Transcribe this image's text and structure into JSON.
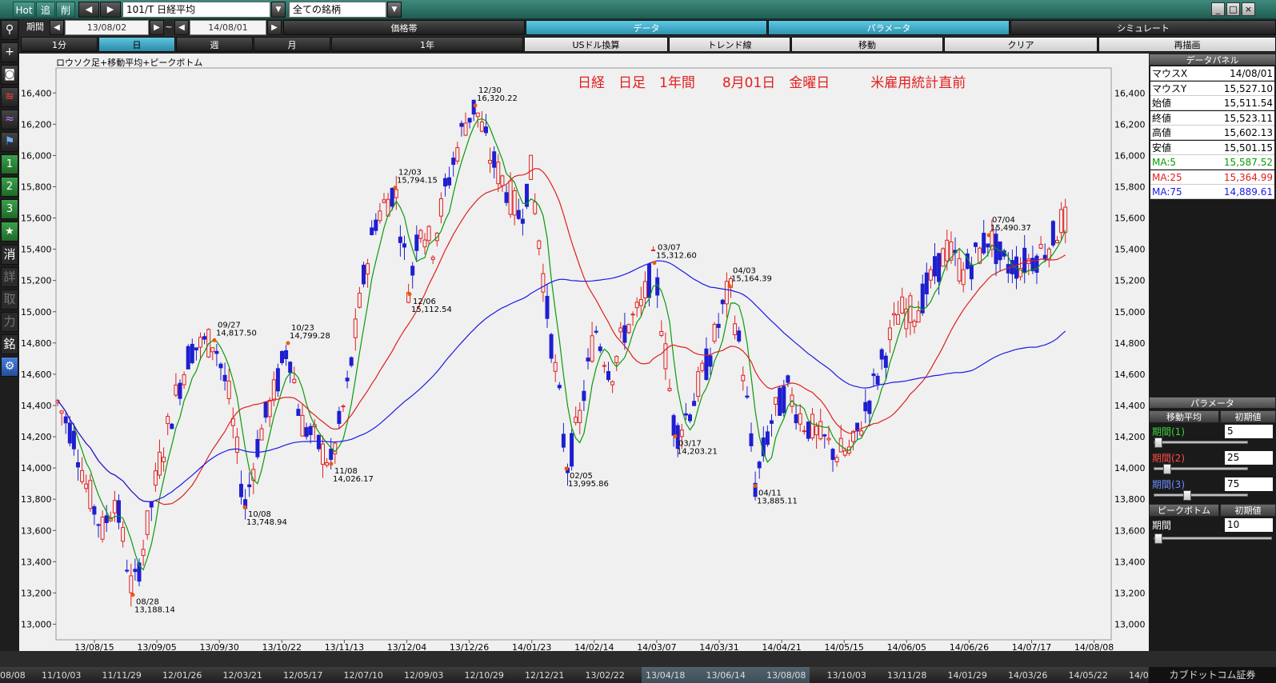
{
  "titlebar": {
    "tabs": [
      "Hot",
      "追",
      "削"
    ],
    "symbol": "101/T 日経平均",
    "universe": "全ての銘柄",
    "win_buttons": [
      "_",
      "□",
      "×"
    ]
  },
  "period_row": {
    "label": "期間",
    "from": "13/08/02",
    "sep": "~",
    "to": "14/08/01",
    "tabs": [
      "価格帯",
      "データ",
      "パラメータ",
      "シミュレート"
    ]
  },
  "range_row": {
    "tabs": [
      "1分",
      "日",
      "週",
      "月",
      "1年",
      "USドル換算",
      "トレンド線",
      "移動",
      "クリア",
      "再描画"
    ]
  },
  "tools": [
    "⚲",
    "+",
    "◙",
    "≋",
    "≈",
    "⚑",
    "1",
    "2",
    "3",
    "★",
    "消",
    "詳",
    "取",
    "力",
    "銘",
    "⚙"
  ],
  "chart": {
    "subtitle": "ロウソク足+移動平均+ピークボトム",
    "title": "日経　日足　1年間　　8月01日　金曜日　　　米雇用統計直前",
    "y_ticks": [
      "16,400",
      "16,200",
      "16,000",
      "15,800",
      "15,600",
      "15,400",
      "15,200",
      "15,000",
      "14,800",
      "14,600",
      "14,400",
      "14,200",
      "14,000",
      "13,800",
      "13,600",
      "13,400",
      "13,200",
      "13,000"
    ],
    "x_ticks": [
      "13/08/15",
      "13/09/05",
      "13/09/30",
      "13/10/22",
      "13/11/13",
      "13/12/04",
      "13/12/26",
      "14/01/23",
      "14/02/14",
      "14/03/07",
      "14/03/31",
      "14/04/21",
      "14/05/15",
      "14/06/05",
      "14/06/26",
      "14/07/17",
      "14/08/08"
    ],
    "colors": {
      "up": "#e02020",
      "down": "#1f1fd0",
      "ma5": "#0a9a0a",
      "ma25": "#e02020",
      "ma75": "#1a1ae6",
      "peak": "#f05a00"
    }
  },
  "chart_data": {
    "type": "candlestick",
    "ylim": [
      12900,
      16560
    ],
    "series": [
      {
        "name": "MA:5",
        "color": "#0a9a0a"
      },
      {
        "name": "MA:25",
        "color": "#e02020"
      },
      {
        "name": "MA:75",
        "color": "#1a1ae6"
      }
    ],
    "annotations": [
      {
        "date": "08/28",
        "value": "13,188.14"
      },
      {
        "date": "09/27",
        "value": "14,817.50"
      },
      {
        "date": "10/08",
        "value": "13,748.94"
      },
      {
        "date": "10/23",
        "value": "14,799.28"
      },
      {
        "date": "11/08",
        "value": "14,026.17"
      },
      {
        "date": "12/03",
        "value": "15,794.15"
      },
      {
        "date": "12/06",
        "value": "15,112.54"
      },
      {
        "date": "12/30",
        "value": "16,320.22"
      },
      {
        "date": "02/05",
        "value": "13,995.86"
      },
      {
        "date": "03/07",
        "value": "15,312.60"
      },
      {
        "date": "03/17",
        "value": "14,203.21"
      },
      {
        "date": "04/03",
        "value": "15,164.39"
      },
      {
        "date": "04/11",
        "value": "13,885.11"
      },
      {
        "date": "07/04",
        "value": "15,490.37"
      }
    ]
  },
  "data_panel": {
    "title": "データパネル",
    "rows": [
      {
        "k": "マウスX",
        "v": "14/08/01"
      },
      {
        "k": "マウスY",
        "v": "15,527.10"
      },
      {
        "k": "始値",
        "v": "15,511.54"
      },
      {
        "k": "終値",
        "v": "15,523.11"
      },
      {
        "k": "高値",
        "v": "15,602.13"
      },
      {
        "k": "安値",
        "v": "15,501.15"
      },
      {
        "k": "MA:5",
        "v": "15,587.52"
      },
      {
        "k": "MA:25",
        "v": "15,364.99"
      },
      {
        "k": "MA:75",
        "v": "14,889.61"
      }
    ]
  },
  "param_panel": {
    "title": "パラメータ",
    "ma_header": "移動平均",
    "reset": "初期値",
    "periods": [
      {
        "label": "期間(1)",
        "value": "5",
        "color": "#3ad43a",
        "level": 0.0
      },
      {
        "label": "期間(2)",
        "value": "25",
        "color": "#ff4a4a",
        "level": 0.1
      },
      {
        "label": "期間(3)",
        "value": "75",
        "color": "#6d8dff",
        "level": 0.33
      }
    ],
    "pb_header": "ピークボトム",
    "pb_reset": "初期値",
    "pb_period_label": "期間",
    "pb_period_value": "10",
    "pb_level": 0.0
  },
  "timeline": {
    "ticks": [
      "08/08",
      "11/10/03",
      "11/11/29",
      "12/01/26",
      "12/03/21",
      "12/05/17",
      "12/07/10",
      "12/09/03",
      "12/10/29",
      "12/12/21",
      "13/02/22",
      "13/04/18",
      "13/06/14",
      "13/08/08",
      "13/10/03",
      "13/11/28",
      "14/01/29",
      "14/03/26",
      "14/05/22",
      "14/07/15"
    ],
    "brand": "カブドットコム証券"
  }
}
